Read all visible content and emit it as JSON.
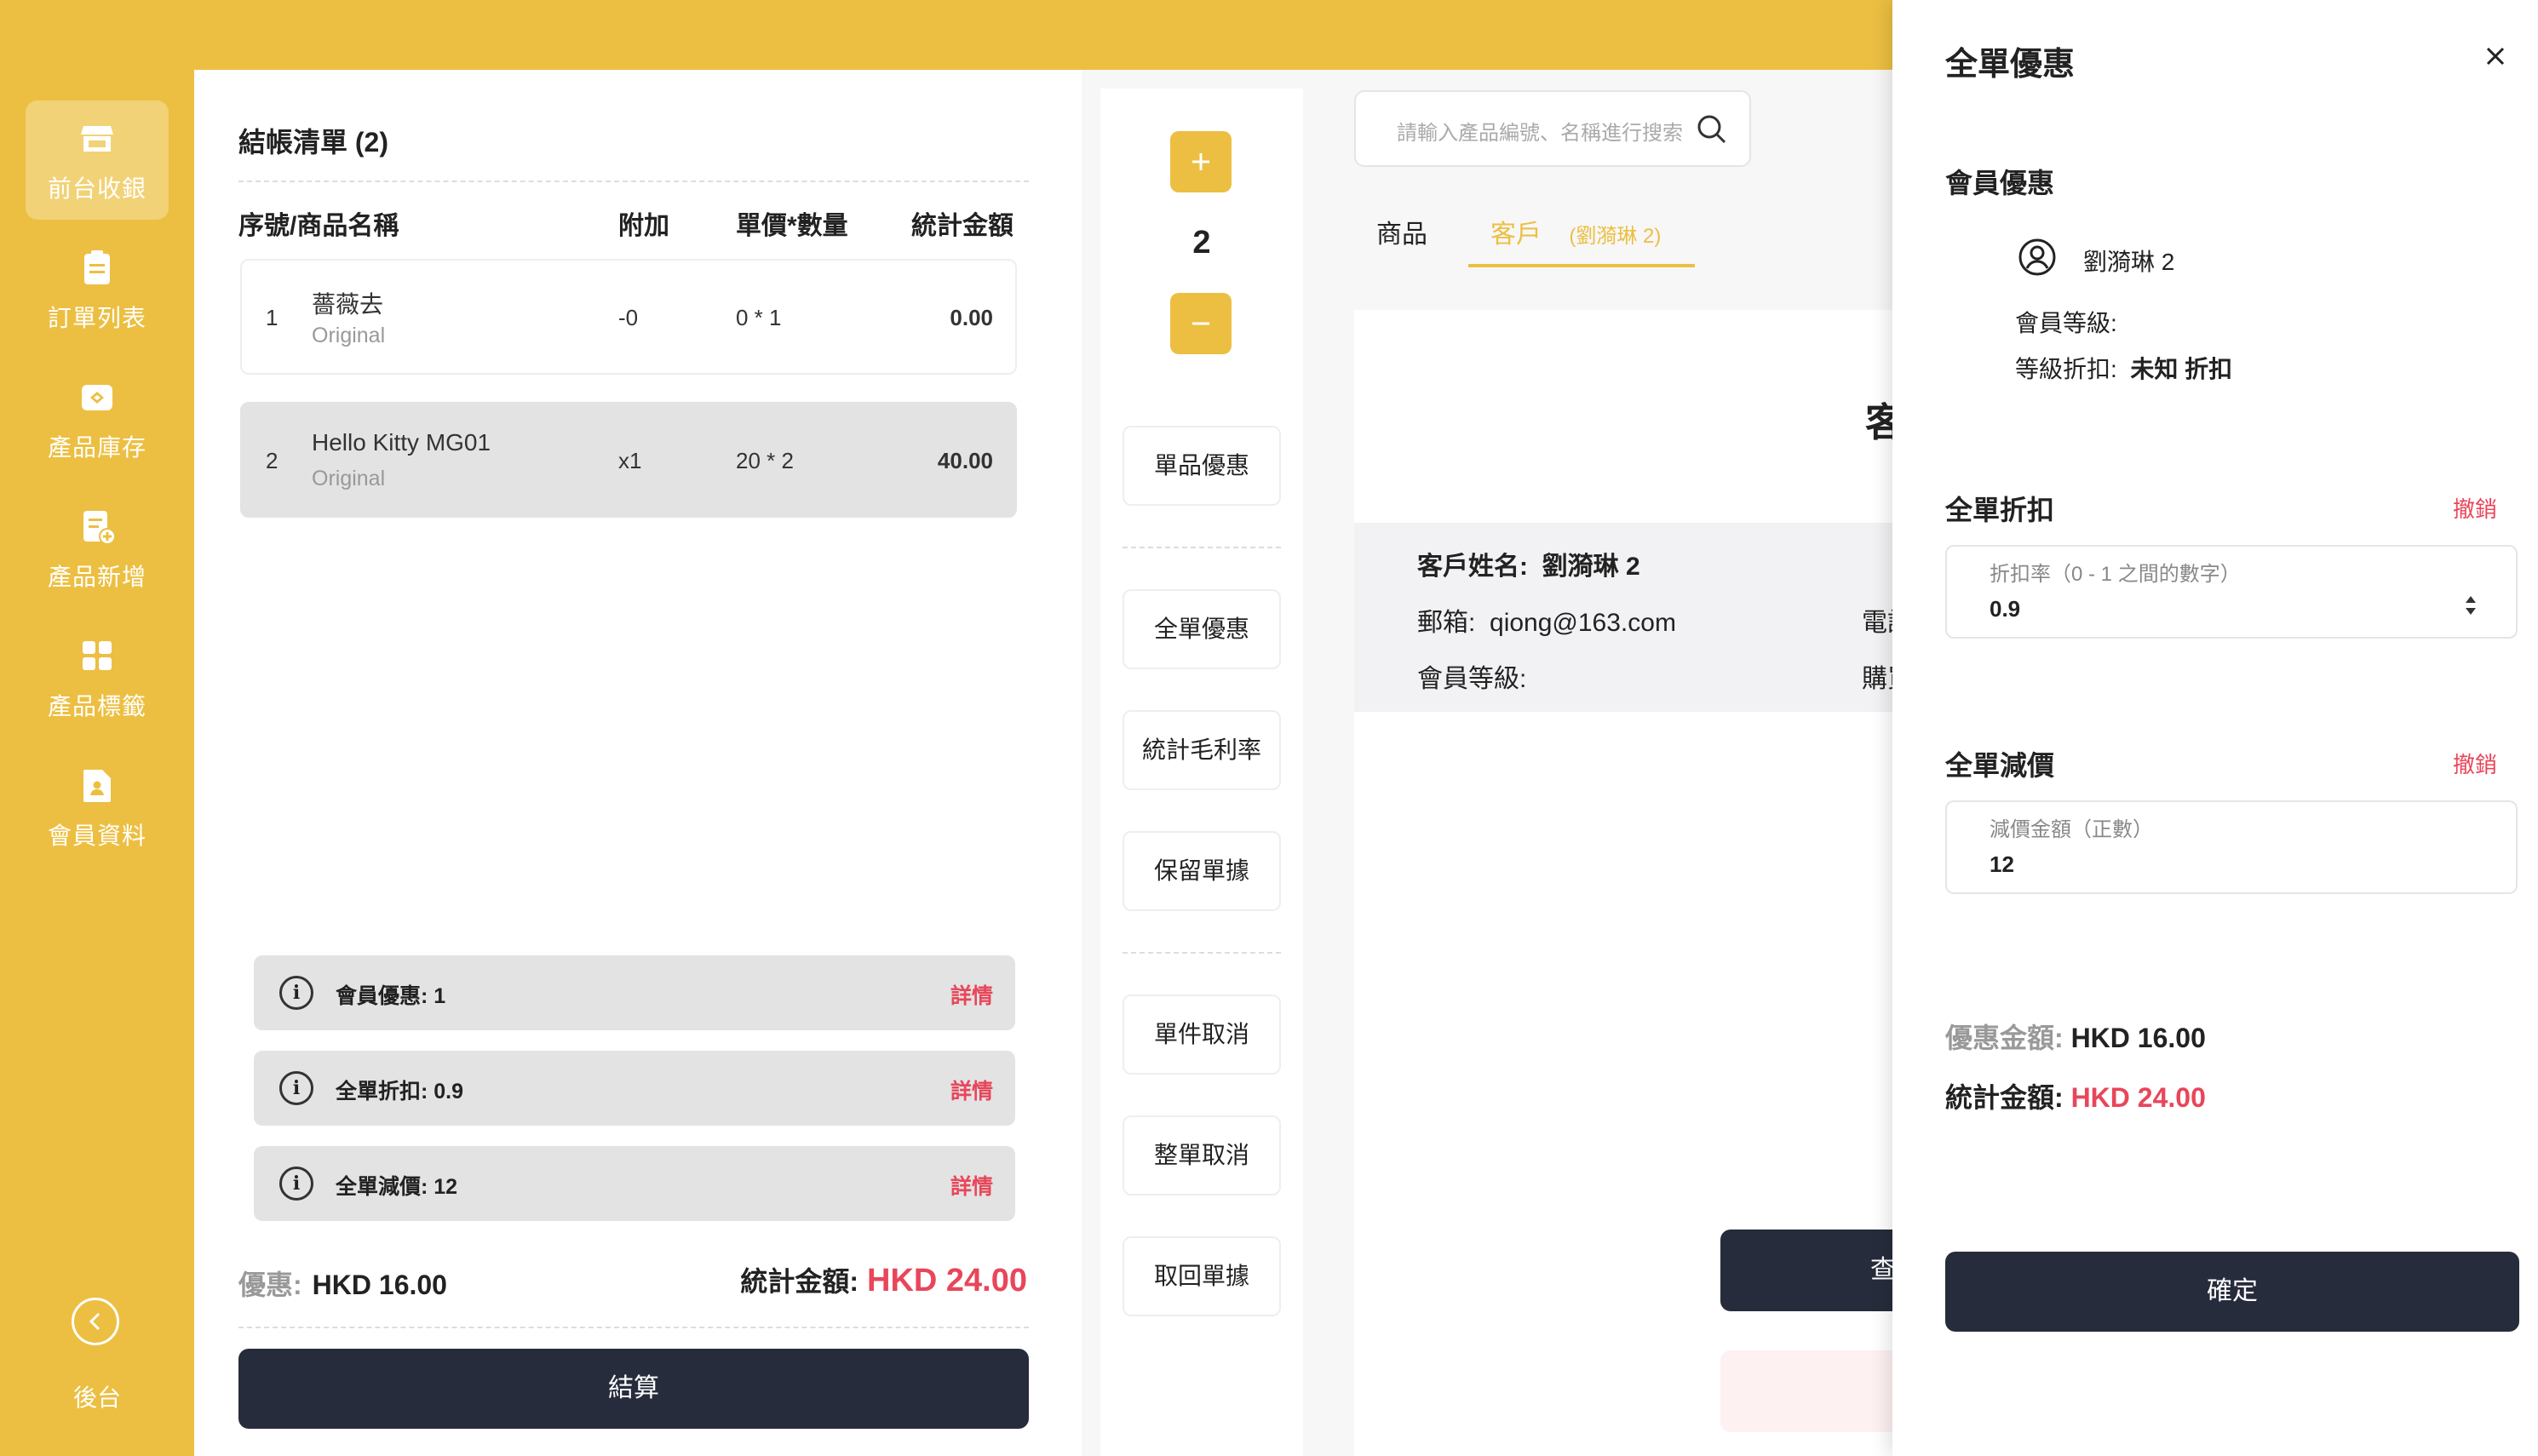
{
  "sidebar": {
    "items": [
      {
        "label": "前台收銀",
        "icon": "store-icon",
        "active": true
      },
      {
        "label": "訂單列表",
        "icon": "clipboard-icon",
        "active": false
      },
      {
        "label": "產品庫存",
        "icon": "inventory-box-icon",
        "active": false
      },
      {
        "label": "產品新增",
        "icon": "add-document-icon",
        "active": false
      },
      {
        "label": "產品標籤",
        "icon": "grid-icon",
        "active": false
      },
      {
        "label": "會員資料",
        "icon": "member-file-icon",
        "active": false
      }
    ],
    "back_label": "後台"
  },
  "cart": {
    "title": "結帳清單 (2)",
    "headers": {
      "name": "序號/商品名稱",
      "extra": "附加",
      "price_qty": "單價*數量",
      "total": "統計金額"
    },
    "rows": [
      {
        "index": "1",
        "name": "薔薇去",
        "variant": "Original",
        "extra": "-0",
        "price_qty": "0 * 1",
        "total": "0.00",
        "selected": false
      },
      {
        "index": "2",
        "name": "Hello Kitty MG01",
        "variant": "Original",
        "extra": "x1",
        "price_qty": "20 * 2",
        "total": "40.00",
        "selected": true
      }
    ],
    "discounts": [
      {
        "label": "會員優惠:  1",
        "link": "詳情"
      },
      {
        "label": "全單折扣:  0.9",
        "link": "詳情"
      },
      {
        "label": "全單減價:  12",
        "link": "詳情"
      }
    ],
    "summary": {
      "discount_label": "優惠:",
      "discount_value": "HKD 16.00",
      "total_label": "統計金額:",
      "total_value": "HKD 24.00"
    },
    "checkout_label": "結算"
  },
  "tools": {
    "quantity": "2",
    "buttons": [
      "單品優惠",
      "全單優惠",
      "統計毛利率",
      "保留單據",
      "單件取消",
      "整單取消",
      "取回單據"
    ]
  },
  "search": {
    "placeholder": "請輸入產品編號、名稱進行搜索"
  },
  "tabs": {
    "products": "商品",
    "customer": "客戶",
    "customer_note": "(劉漪琳 2)"
  },
  "customer_panel": {
    "heading_partial": "客",
    "name_label": "客戶姓名:",
    "name_value": "劉漪琳 2",
    "email_label": "郵箱:",
    "email_value": "qiong@163.com",
    "level_label": "會員等級:",
    "phone_partial": "電話",
    "purchase_partial": "購買",
    "button_partial": "查"
  },
  "drawer": {
    "title": "全單優惠",
    "member_section": "會員優惠",
    "member_name": "劉漪琳 2",
    "member_level_label": "會員等級:",
    "grade_discount_label": "等級折扣:",
    "grade_discount_value": "未知 折扣",
    "discount_section": "全單折扣",
    "discount_undo": "撤銷",
    "discount_field_label": "折扣率（0 - 1 之間的數字）",
    "discount_field_value": "0.9",
    "reduce_section": "全單減價",
    "reduce_undo": "撤銷",
    "reduce_field_label": "減價金額（正數）",
    "reduce_field_value": "12",
    "discount_amount_label": "優惠金額:",
    "discount_amount_value": "HKD 16.00",
    "total_label": "統計金額:",
    "total_value": "HKD 24.00",
    "confirm_label": "確定"
  },
  "colors": {
    "accent": "#ECBF42",
    "dark_button": "#272C3C",
    "alert": "#E8465A"
  }
}
